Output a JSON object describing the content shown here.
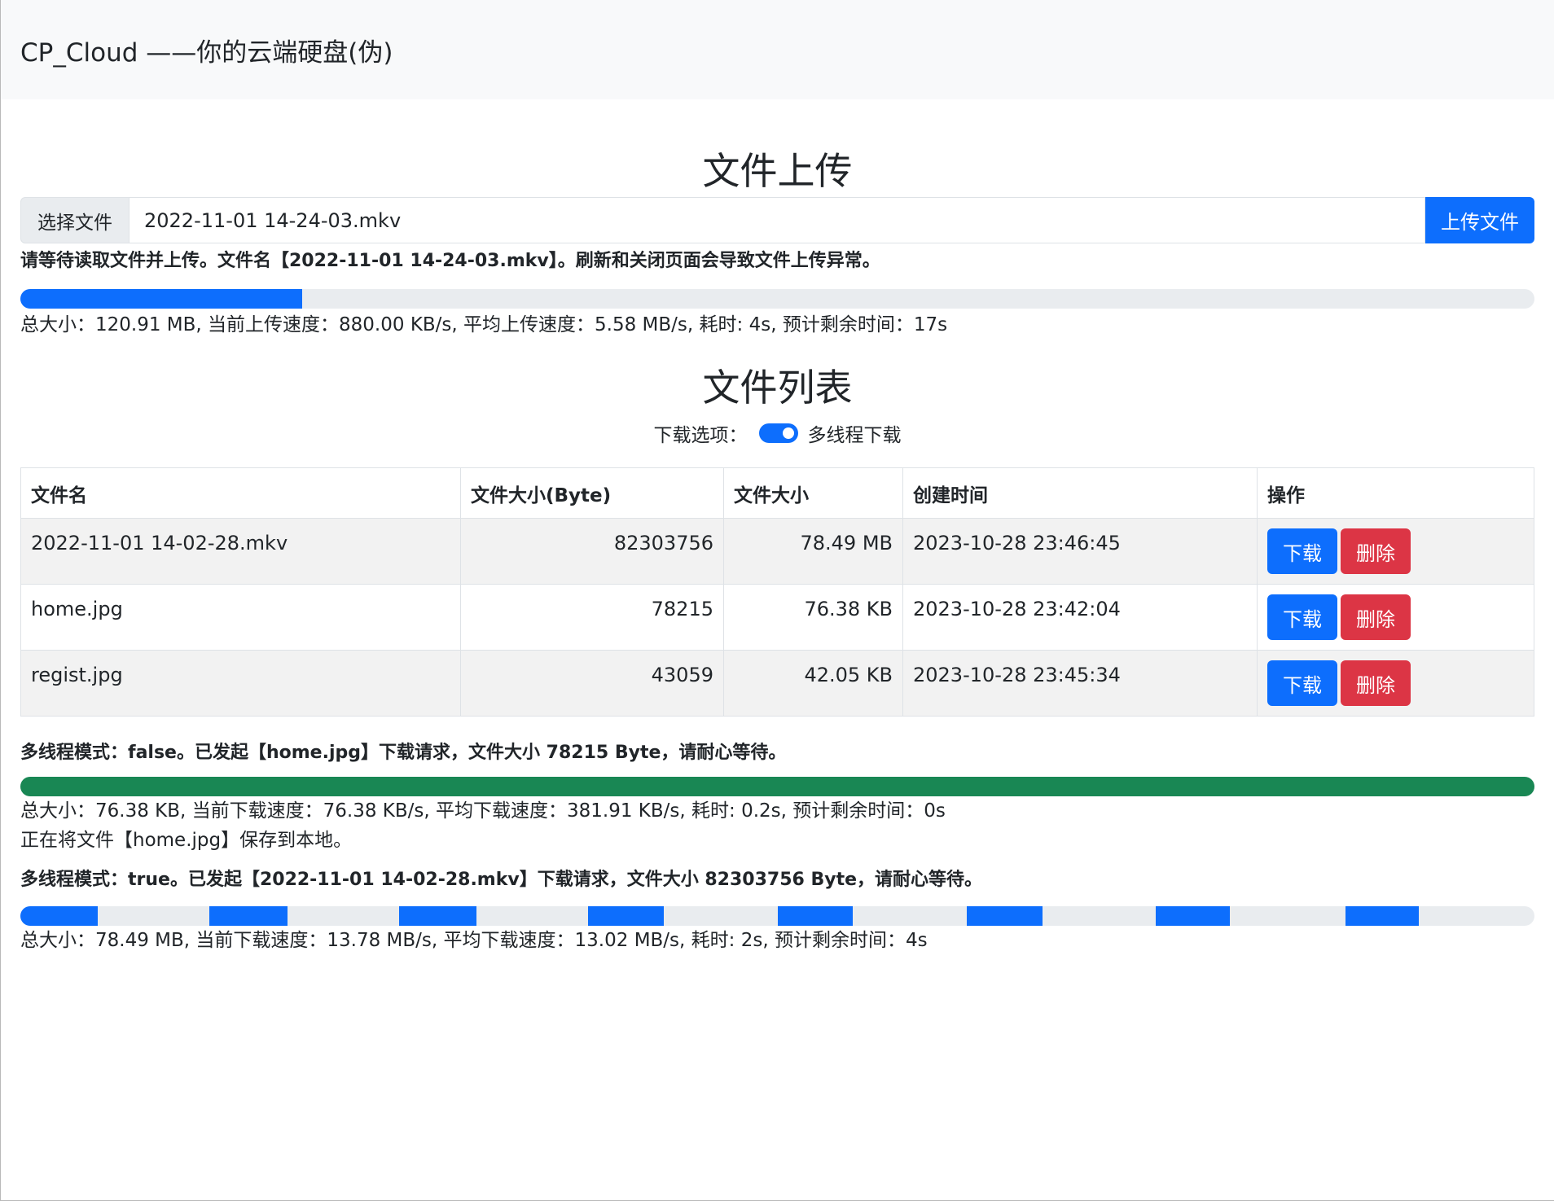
{
  "header": {
    "brand": "CP_Cloud ——你的云端硬盘(伪)"
  },
  "upload": {
    "title": "文件上传",
    "choose_label": "选择文件",
    "file_name": "2022-11-01 14-24-03.mkv",
    "upload_button": "上传文件",
    "message": "请等待读取文件并上传。文件名【2022-11-01 14-24-03.mkv】。刷新和关闭页面会导致文件上传异常。",
    "progress": 0.186,
    "progress_color": "#0d6efd",
    "stats": "总大小：120.91 MB, 当前上传速度：880.00 KB/s, 平均上传速度：5.58 MB/s, 耗时: 4s, 预计剩余时间：17s"
  },
  "file_list": {
    "title": "文件列表",
    "option_label": "下载选项：",
    "toggle_label": "多线程下载",
    "toggle_on": true,
    "columns": [
      "文件名",
      "文件大小(Byte)",
      "文件大小",
      "创建时间",
      "操作"
    ],
    "rows": [
      {
        "name": "2022-11-01 14-02-28.mkv",
        "bytes": "82303756",
        "size": "78.49 MB",
        "created": "2023-10-28 23:46:45",
        "download": "下载",
        "delete": "删除"
      },
      {
        "name": "home.jpg",
        "bytes": "78215",
        "size": "76.38 KB",
        "created": "2023-10-28 23:42:04",
        "download": "下载",
        "delete": "删除"
      },
      {
        "name": "regist.jpg",
        "bytes": "43059",
        "size": "42.05 KB",
        "created": "2023-10-28 23:45:34",
        "download": "下载",
        "delete": "删除"
      }
    ]
  },
  "downloads": [
    {
      "message": "多线程模式：false。已发起【home.jpg】下载请求，文件大小 78215 Byte，请耐心等待。",
      "progress": 1.0,
      "progress_color": "#198754",
      "stats": "总大小：76.38 KB, 当前下载速度：76.38 KB/s, 平均下载速度：381.91 KB/s, 耗时: 0.2s, 预计剩余时间：0s",
      "note": "正在将文件【home.jpg】保存到本地。"
    },
    {
      "message": "多线程模式：true。已发起【2022-11-01 14-02-28.mkv】下载请求，文件大小 82303756 Byte，请耐心等待。",
      "progress_color": "#0d6efd",
      "chunks": 8,
      "chunk_progress": [
        0.41,
        0.41,
        0.41,
        0.4,
        0.4,
        0.4,
        0.39,
        0.39
      ],
      "stats": "总大小：78.49 MB, 当前下载速度：13.78 MB/s, 平均下载速度：13.02 MB/s, 耗时: 2s, 预计剩余时间：4s"
    }
  ]
}
